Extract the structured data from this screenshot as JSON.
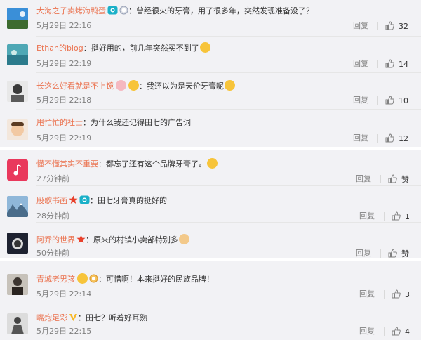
{
  "comments": [
    {
      "user": "大海之子卖烤海鸭蛋",
      "text": "：曾经很火的牙膏，用了很多年，突然发现准备没了？",
      "time": "5月29日 22:16",
      "reply": "回复",
      "likes": "32"
    },
    {
      "user": "Ethan的blog",
      "text": "：挺好用的，前几年突然买不到了",
      "time": "5月29日 22:19",
      "reply": "回复",
      "likes": "14"
    },
    {
      "user": "长这么好看就是不上镜",
      "text": "：我还以为是天价牙膏呢",
      "time": "5月29日 22:18",
      "reply": "回复",
      "likes": "10"
    },
    {
      "user": "甩忙忙的社士",
      "text": "：为什么我还记得田七的广告词",
      "time": "5月29日 22:19",
      "reply": "回复",
      "likes": "12"
    },
    {
      "user": "懂不懂其实不重要",
      "text": "：都忘了还有这个品牌牙膏了。",
      "time": "27分钟前",
      "reply": "回复",
      "likes": "赞"
    },
    {
      "user": "股歌书画",
      "text": "：田七牙膏真的挺好的",
      "time": "28分钟前",
      "reply": "回复",
      "likes": "1"
    },
    {
      "user": "阿乔的世界",
      "text": "：原来的村镇小卖部特别多",
      "time": "50分钟前",
      "reply": "回复",
      "likes": "赞"
    },
    {
      "user": "青城老男孩",
      "text": "：可惜啊！本来挺好的民族品牌！",
      "time": "5月29日 22:14",
      "reply": "回复",
      "likes": "3"
    },
    {
      "user": "嘴炮足彩",
      "text": "：田七？听着好耳熟",
      "time": "5月29日 22:15",
      "reply": "回复",
      "likes": "4"
    }
  ],
  "colors": {
    "username": "#eb7350",
    "meta": "#808080",
    "text": "#333333",
    "background": "#f2f2f5"
  }
}
